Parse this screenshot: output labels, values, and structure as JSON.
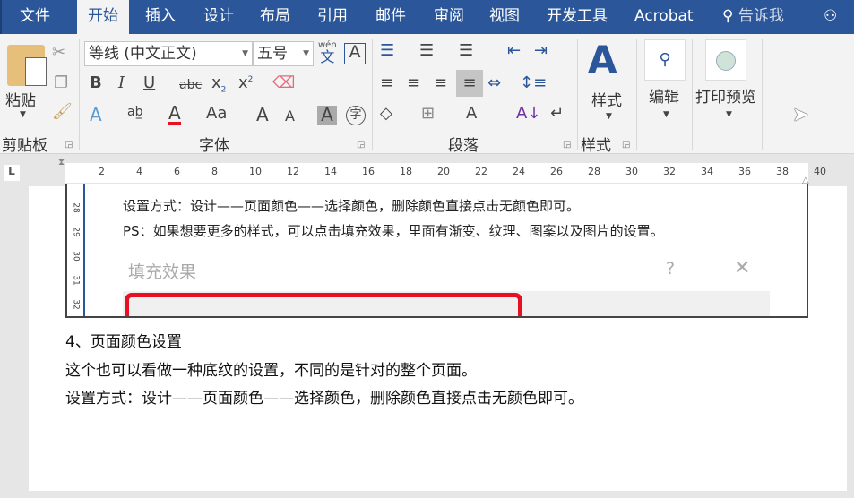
{
  "tabs": [
    "文件",
    "开始",
    "插入",
    "设计",
    "布局",
    "引用",
    "邮件",
    "审阅",
    "视图",
    "开发工具",
    "Acrobat"
  ],
  "tell_me": "告诉我",
  "clipboard": {
    "paste": "粘贴",
    "group": "剪贴板"
  },
  "font": {
    "name": "等线 (中文正文)",
    "size": "五号",
    "group": "字体",
    "phonetic": "wén",
    "phonetic_char": "文",
    "change_case": "Aa",
    "bold": "B",
    "italic": "I",
    "underline": "U",
    "strike": "abc",
    "enclose": "字"
  },
  "paragraph": {
    "group": "段落"
  },
  "styles": {
    "label": "样式",
    "group": "样式"
  },
  "editing": {
    "label": "编辑"
  },
  "print_preview": {
    "label": "打印预览"
  },
  "ruler": [
    "2",
    "4",
    "6",
    "8",
    "10",
    "12",
    "14",
    "16",
    "18",
    "20",
    "22",
    "24",
    "26",
    "28",
    "30",
    "32",
    "34",
    "36",
    "38",
    "40"
  ],
  "vruler": [
    "28",
    "29",
    "30",
    "31",
    "32"
  ],
  "embedded": {
    "line1": "设置方式：设计——页面颜色——选择颜色，删除颜色直接点击无颜色即可。",
    "line2": "PS：如果想要更多的样式，可以点击填充效果，里面有渐变、纹理、图案以及图片的设置。",
    "dialog_title": "填充效果",
    "help": "?",
    "close": "✕"
  },
  "document": [
    "4、页面颜色设置",
    "这个也可以看做一种底纹的设置，不同的是针对的整个页面。",
    "设置方式：设计——页面颜色——选择颜色，删除颜色直接点击无颜色即可。"
  ],
  "colors": {
    "accent": "#2b579a",
    "red": "#e81123"
  }
}
